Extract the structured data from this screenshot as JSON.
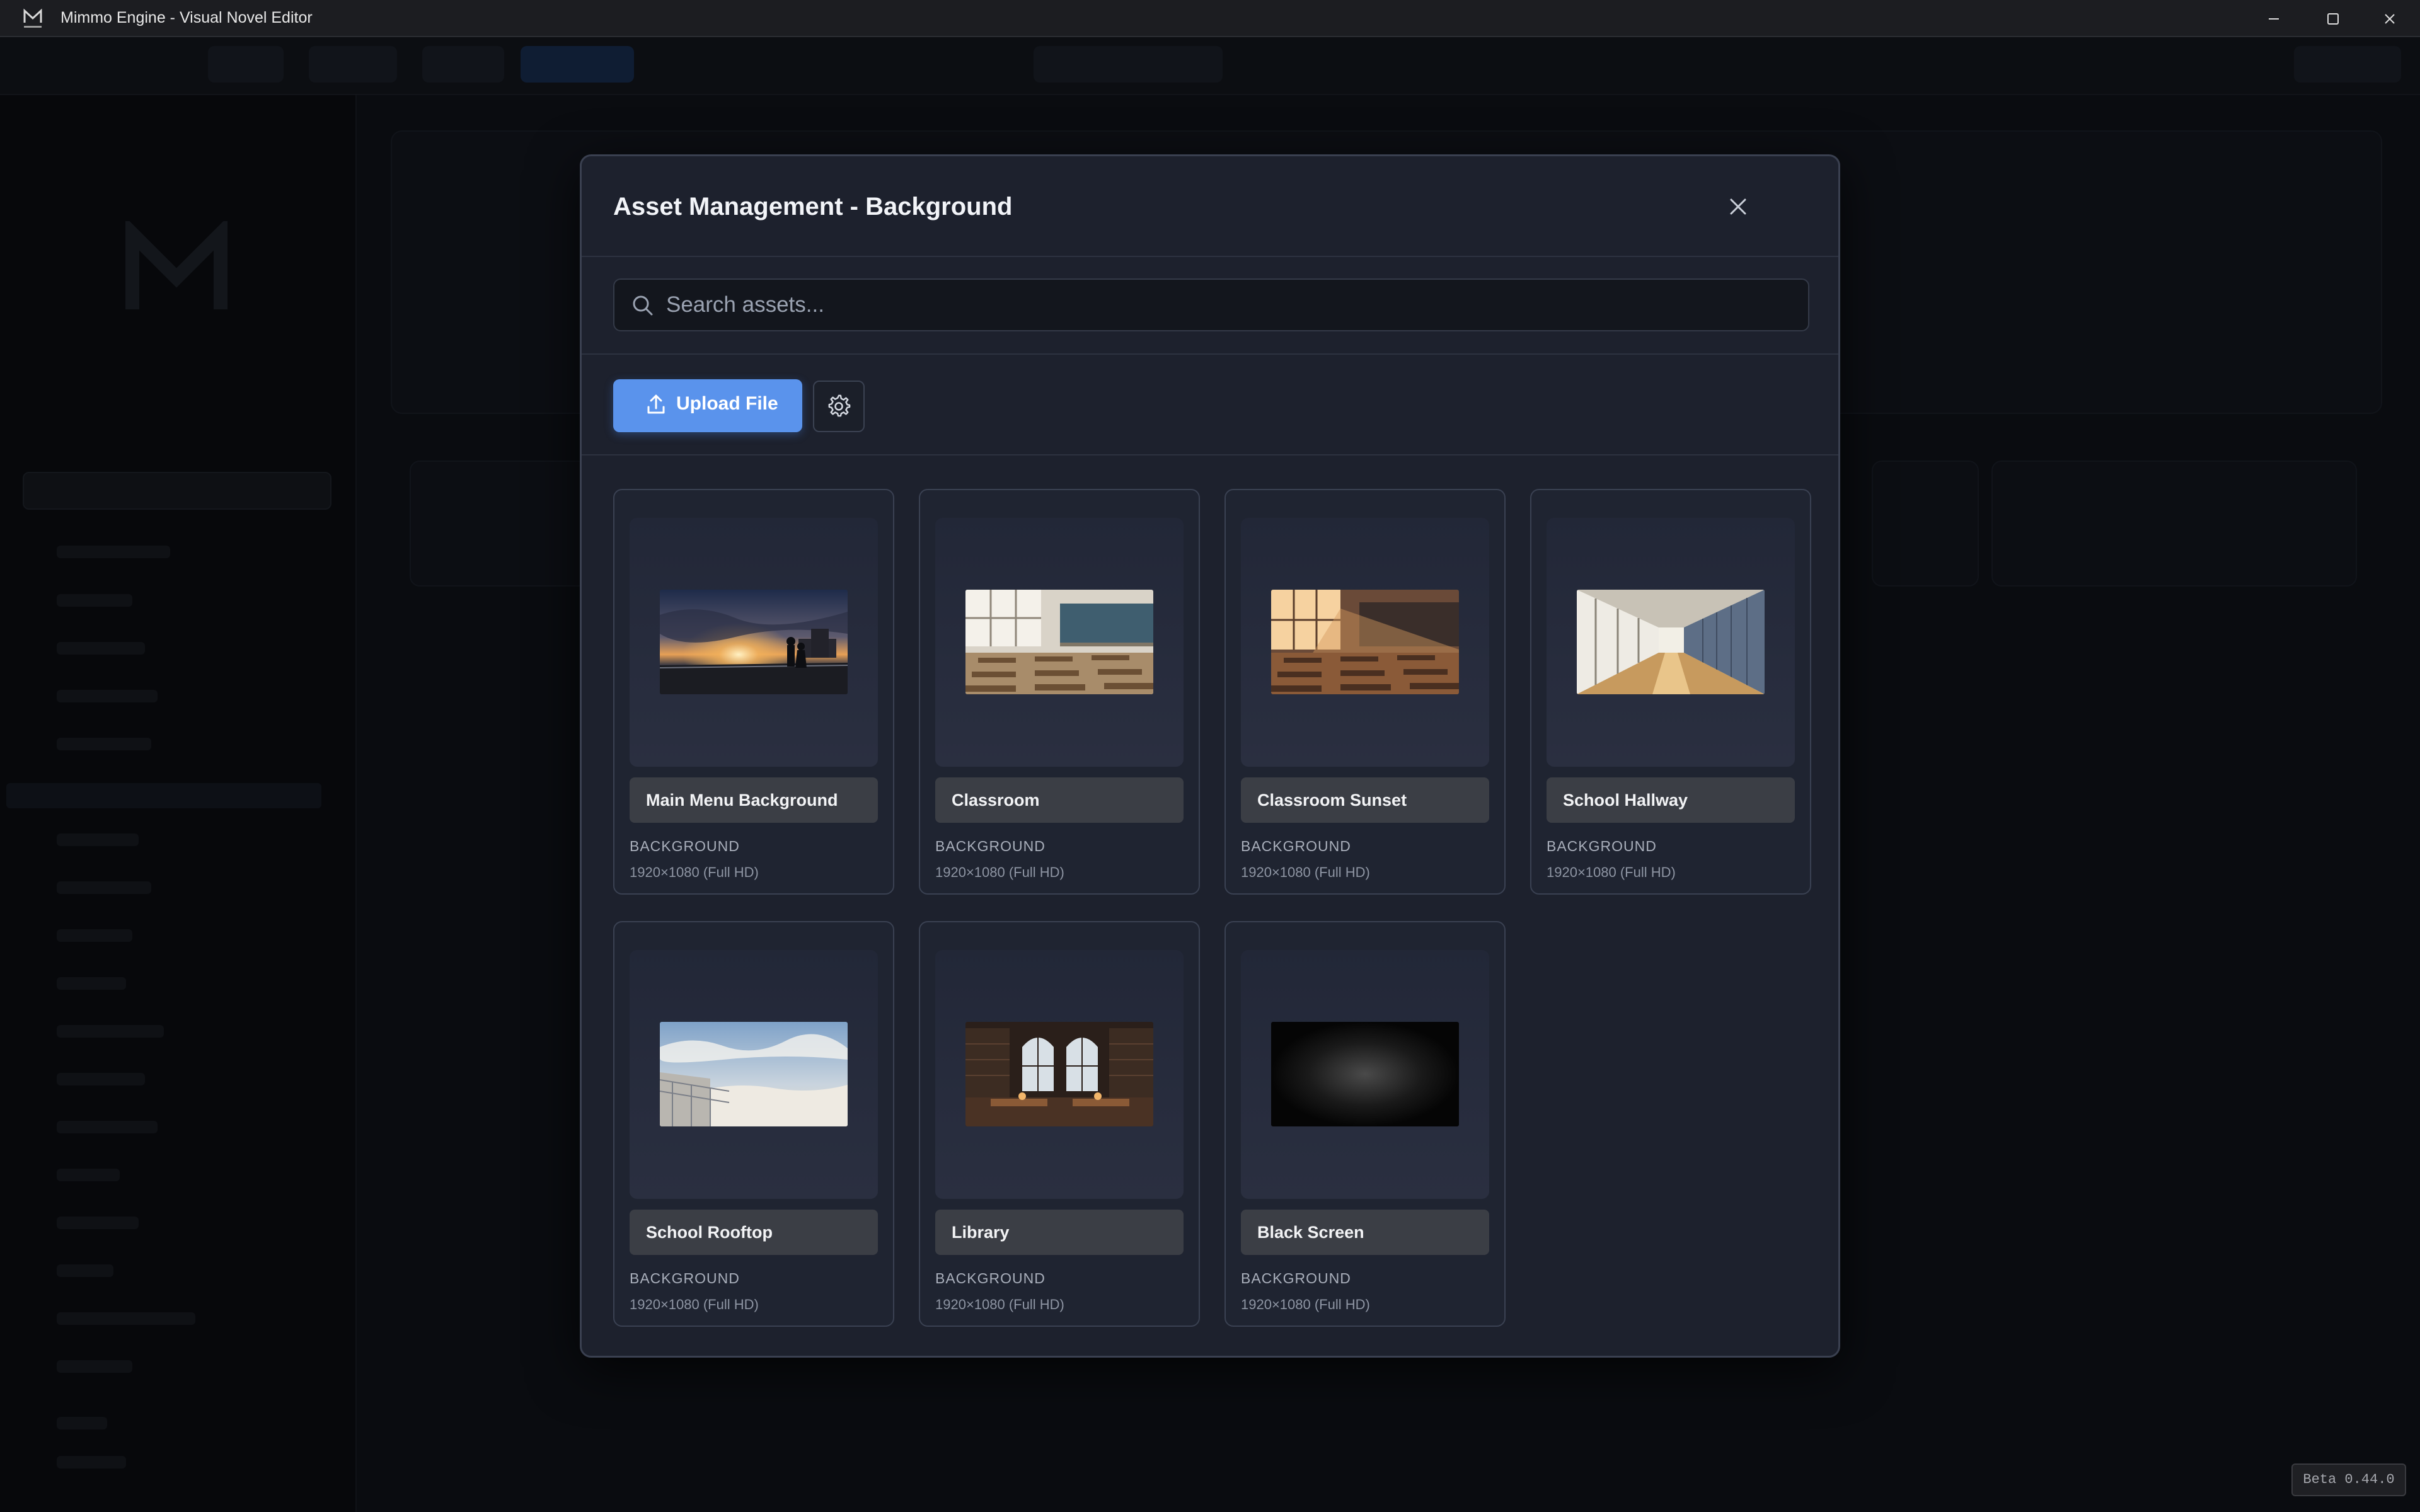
{
  "window": {
    "title": "Mimmo Engine - Visual Novel Editor",
    "logo_icon": "mimmo-logo-icon",
    "controls": [
      "minimize-icon",
      "maximize-icon",
      "close-icon"
    ]
  },
  "modal": {
    "title": "Asset Management - Background",
    "close_icon": "close-icon",
    "search": {
      "placeholder": "Search assets...",
      "value": "",
      "icon": "search-icon"
    },
    "upload_button": {
      "label": "Upload File",
      "icon": "upload-icon"
    },
    "settings_button": {
      "icon": "gear-icon"
    },
    "assets": [
      {
        "name": "Main Menu Background",
        "type": "BACKGROUND",
        "resolution": "1920×1080 (Full HD)",
        "thumbnail": "rooftop-sunset-couple"
      },
      {
        "name": "Classroom",
        "type": "BACKGROUND",
        "resolution": "1920×1080 (Full HD)",
        "thumbnail": "classroom-day"
      },
      {
        "name": "Classroom Sunset",
        "type": "BACKGROUND",
        "resolution": "1920×1080 (Full HD)",
        "thumbnail": "classroom-sunset"
      },
      {
        "name": "School Hallway",
        "type": "BACKGROUND",
        "resolution": "1920×1080 (Full HD)",
        "thumbnail": "school-hallway"
      },
      {
        "name": "School Rooftop",
        "type": "BACKGROUND",
        "resolution": "1920×1080 (Full HD)",
        "thumbnail": "rooftop-sky"
      },
      {
        "name": "Library",
        "type": "BACKGROUND",
        "resolution": "1920×1080 (Full HD)",
        "thumbnail": "library-interior"
      },
      {
        "name": "Black Screen",
        "type": "BACKGROUND",
        "resolution": "1920×1080 (Full HD)",
        "thumbnail": "black-vignette"
      }
    ]
  },
  "version_badge": "Beta 0.44.0",
  "colors": {
    "accent": "#5a93ec",
    "modal_bg": "#1d212d",
    "card_bg": "#1f2431",
    "card_label_bg": "#3b3e45"
  }
}
